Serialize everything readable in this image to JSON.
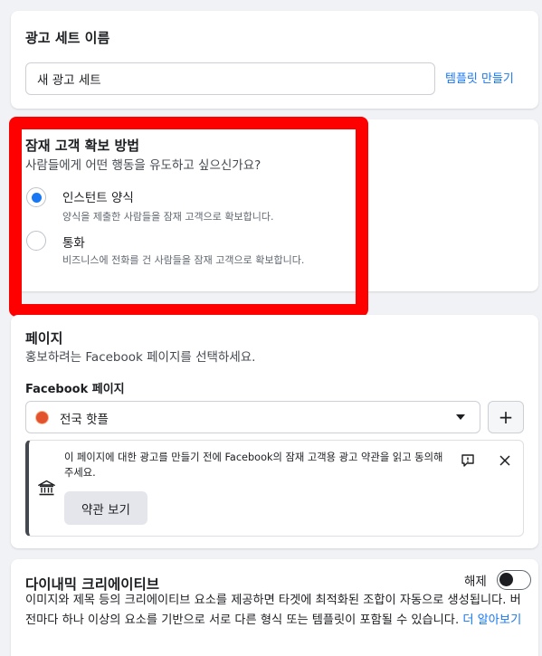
{
  "ad_set_name": {
    "title": "광고 세트 이름",
    "input_value": "새 광고 세트",
    "template_link": "템플릿 만들기"
  },
  "lead_method": {
    "title": "잠재 고객 확보 방법",
    "subtitle": "사람들에게 어떤 행동을 유도하고 싶으신가요?",
    "options": [
      {
        "label": "인스턴트 양식",
        "description": "양식을 제출한 사람들을 잠재 고객으로 확보합니다.",
        "checked": true
      },
      {
        "label": "통화",
        "description": "비즈니스에 전화를 건 사람들을 잠재 고객으로 확보합니다.",
        "checked": false
      }
    ],
    "highlight_color": "#ff0000"
  },
  "page": {
    "title": "페이지",
    "subtitle": "홍보하려는 Facebook 페이지를 선택하세요.",
    "field_label": "Facebook 페이지",
    "selected_page": "전국 핫플",
    "add_button": "+",
    "notice": {
      "text": "이 페이지에 대한 광고를 만들기 전에 Facebook의 잠재 고객용 광고 약관을 읽고 동의해주세요.",
      "button_label": "약관 보기"
    }
  },
  "dynamic_creative": {
    "title": "다이내믹 크리에이티브",
    "toggle_label": "해제",
    "toggle_on": false,
    "description": "이미지와 제목 등의 크리에이티브 요소를 제공하면 타겟에 최적화된 조합이 자동으로 생성됩니다. 버전마다 하나 이상의 요소를 기반으로 서로 다른 형식 또는 템플릿이 포함될 수 있습니다.",
    "learn_more": "더 알아보기"
  },
  "colors": {
    "accent": "#1877f2",
    "background": "#f0f2f5"
  }
}
